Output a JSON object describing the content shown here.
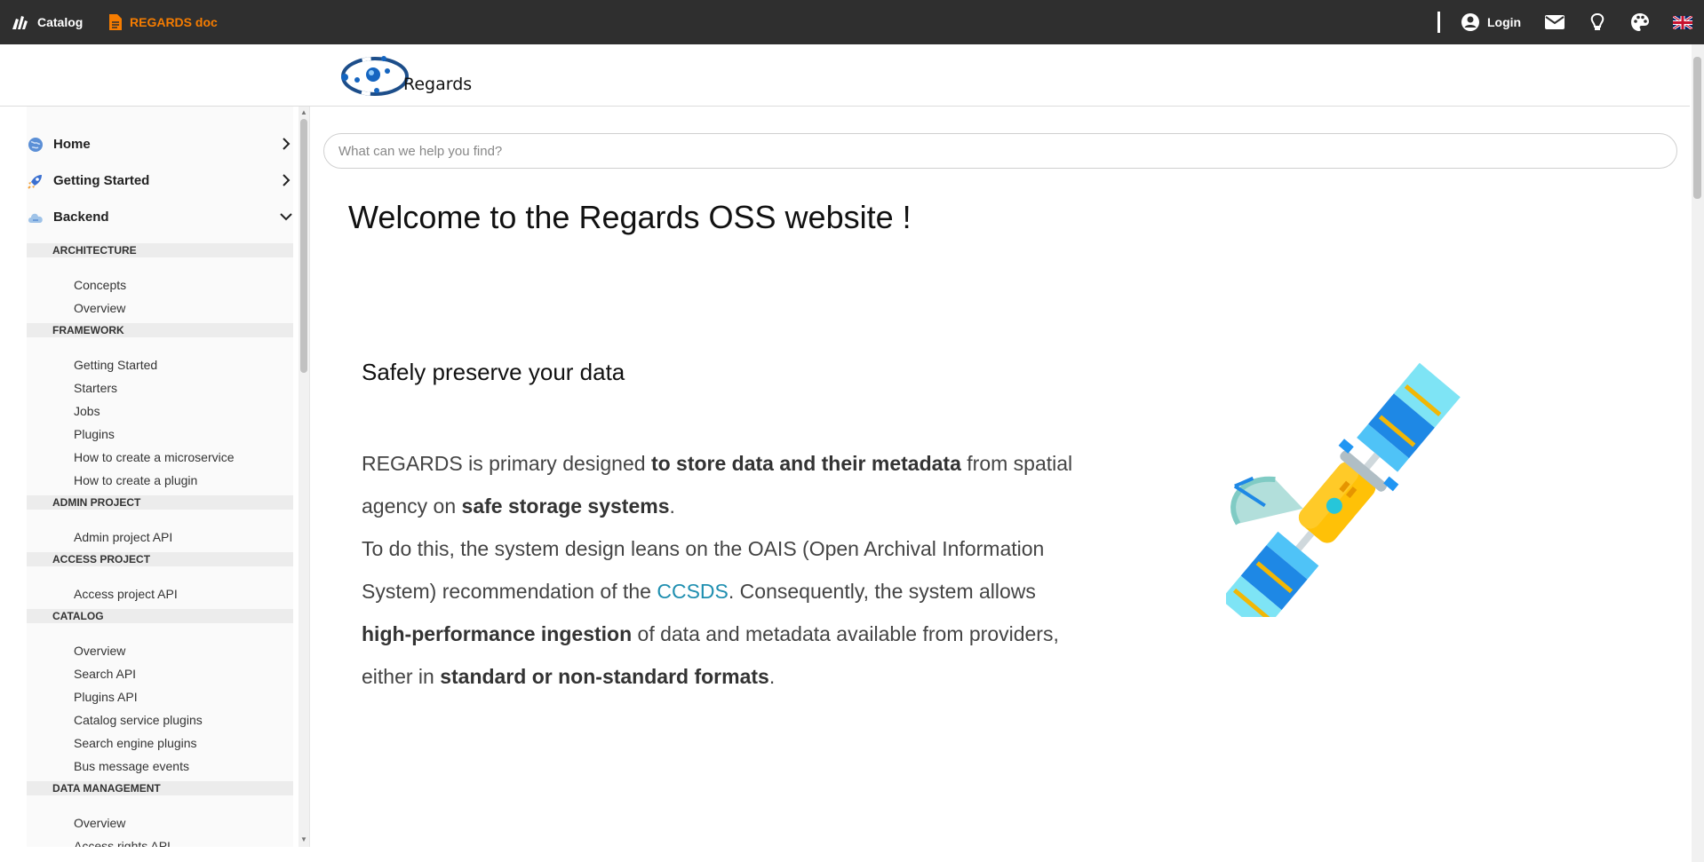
{
  "topbar": {
    "catalog_label": "Catalog",
    "doc_label": "REGARDS doc",
    "login_label": "Login",
    "accent": "#f57c00",
    "background": "#2f2f2f"
  },
  "logo": {
    "text": "Regards"
  },
  "sidebar": {
    "top_items": [
      {
        "label": "Home",
        "icon": "globe-icon",
        "chevron": "chevron-right-icon"
      },
      {
        "label": "Getting Started",
        "icon": "rocket-icon",
        "chevron": "chevron-right-icon"
      },
      {
        "label": "Backend",
        "icon": "cloud-icon",
        "chevron": "chevron-down-icon"
      }
    ],
    "sections": [
      {
        "title": "ARCHITECTURE",
        "items": [
          "Concepts",
          "Overview"
        ]
      },
      {
        "title": "FRAMEWORK",
        "items": [
          "Getting Started",
          "Starters",
          "Jobs",
          "Plugins",
          "How to create a microservice",
          "How to create a plugin"
        ]
      },
      {
        "title": "ADMIN PROJECT",
        "items": [
          "Admin project API"
        ]
      },
      {
        "title": "ACCESS PROJECT",
        "items": [
          "Access project API"
        ]
      },
      {
        "title": "CATALOG",
        "items": [
          "Overview",
          "Search API",
          "Plugins API",
          "Catalog service plugins",
          "Search engine plugins",
          "Bus message events"
        ]
      },
      {
        "title": "DATA MANAGEMENT",
        "items": [
          "Overview",
          "Access rights API"
        ]
      }
    ]
  },
  "search": {
    "placeholder": "What can we help you find?"
  },
  "main": {
    "title": "Welcome to the Regards OSS website !",
    "subtitle": "Safely preserve your data",
    "p1_a": "REGARDS is primary designed ",
    "p1_b": "to store data and their metadata",
    "p1_c": " from spatial agency on ",
    "p1_d": "safe storage systems",
    "p1_e": ".",
    "p2_a": "To do this, the system design leans on the OAIS (Open Archival Information System) recommendation of the ",
    "p2_link": "CCSDS",
    "p2_b": ". Consequently, the system allows ",
    "p2_c": "high-performance ingestion",
    "p2_d": " of data and metadata available from providers, either in ",
    "p2_e": "standard or non-standard formats",
    "p2_f": ".",
    "link_color": "#1f8fb0"
  }
}
